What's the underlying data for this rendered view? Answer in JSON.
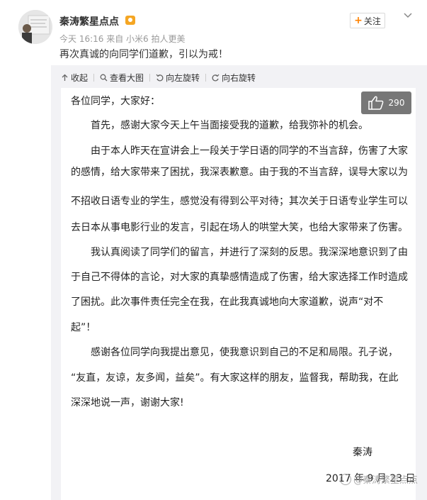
{
  "post": {
    "user_name": "秦涛繁星点点",
    "meta": "今天 16:16 来自 小米6 拍人更美",
    "text": "再次真诚的向同学们道歉，引以为戒！",
    "follow_label": "关注",
    "follow_plus": "+"
  },
  "toolbar": {
    "items": [
      {
        "label": "收起",
        "icon": "collapse-icon"
      },
      {
        "label": "查看大图",
        "icon": "search-icon"
      },
      {
        "label": "向左旋转",
        "icon": "rotate-left-icon"
      },
      {
        "label": "向右旋转",
        "icon": "rotate-right-icon"
      }
    ]
  },
  "like": {
    "count": "290",
    "icon": "thumbs-up-icon"
  },
  "letter": {
    "lines": [
      "各位同学，大家好：",
      "首先，感谢大家今天上午当面接受我的道歉，给我弥补的机会。",
      "由于本人昨天在宣讲会上一段关于学日语的同学的不当言辞，伤害了大家",
      "的感情，给大家带来了困扰，我深表歉意。由于我的不当言辞，误导大家以为",
      "不招收日语专业的学生，感觉没有得到公平对待；其次关于日语专业学生可以",
      "去日本从事电影行业的发言，引起在场人的哄堂大笑，也给大家带来了伤害。",
      "我认真阅读了同学们的留言，并进行了深刻的反思。我深深地意识到了由",
      "于自己不得体的言论，对大家的真挚感情造成了伤害，给大家选择工作时造成",
      "了困扰。此次事件责任完全在我，在此我真诚地向大家道歉，说声“对不",
      "起”！",
      "感谢各位同学向我提出意见，使我意识到自己的不足和局限。孔子说，",
      "“友直，友谅，友多闻，益矣”。有大家这样的朋友，监督我，帮助我，在此",
      "深深地说一声，谢谢大家!"
    ],
    "signature_name": "秦涛",
    "signature_date": "2017 年 9 月 23 日"
  },
  "watermark": "@秦涛繁星点点"
}
